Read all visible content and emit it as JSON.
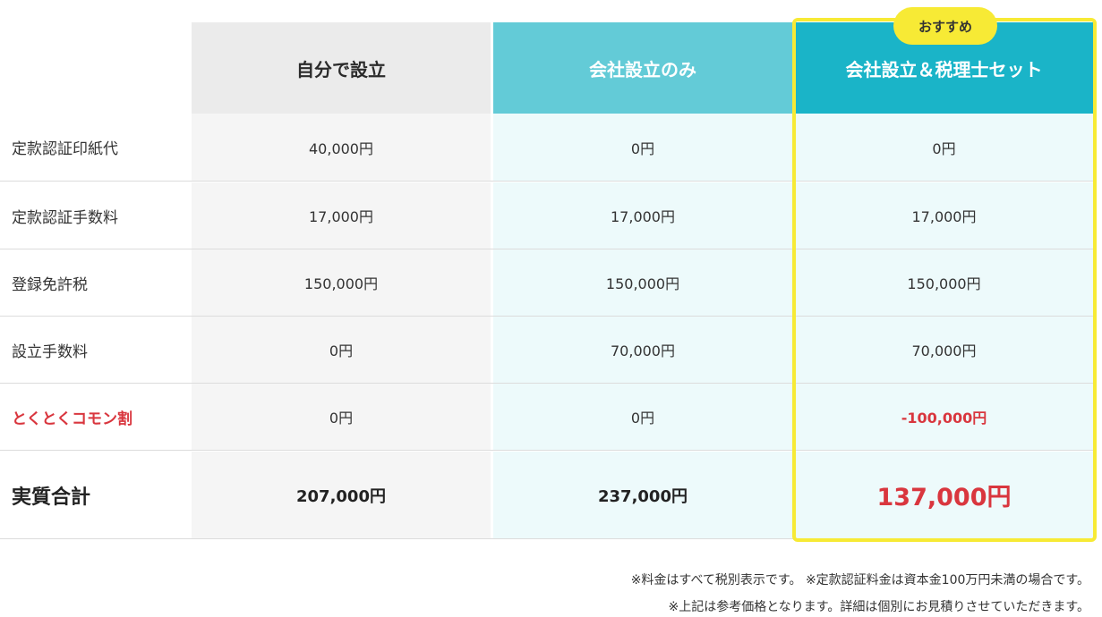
{
  "header": {
    "columns": [
      "自分で設立",
      "会社設立のみ",
      "会社設立＆税理士セット"
    ],
    "recommended_badge": "おすすめ"
  },
  "rows": [
    {
      "label": "定款認証印紙代",
      "values": [
        "40,000円",
        "0円",
        "0円"
      ]
    },
    {
      "label": "定款認証手数料",
      "values": [
        "17,000円",
        "17,000円",
        "17,000円"
      ]
    },
    {
      "label": "登録免許税",
      "values": [
        "150,000円",
        "150,000円",
        "150,000円"
      ]
    },
    {
      "label": "設立手数料",
      "values": [
        "0円",
        "70,000円",
        "70,000円"
      ]
    },
    {
      "label": "とくとくコモン割",
      "values": [
        "0円",
        "0円",
        "-100,000円"
      ]
    }
  ],
  "total": {
    "label": "実質合計",
    "values": [
      "207,000円",
      "237,000円",
      "137,000円"
    ]
  },
  "notes": [
    "※料金はすべて税別表示です。 ※定款認証料金は資本金100万円未満の場合です。",
    "※上記は参考価格となります。詳細は個別にお見積りさせていただきます。"
  ],
  "colors": {
    "self_header": "#ebebeb",
    "only_header": "#63cbd7",
    "set_header": "#1ab4c8",
    "highlight": "#f7ea35",
    "discount_red": "#d9363e"
  }
}
